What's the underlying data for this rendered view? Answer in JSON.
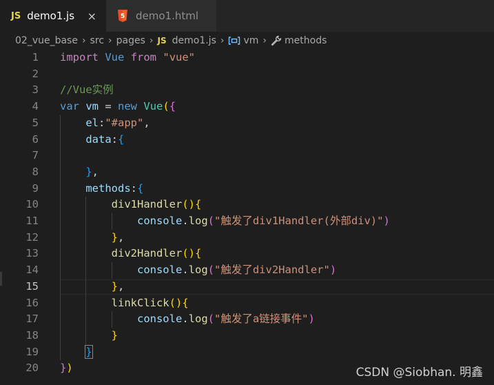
{
  "tabs": [
    {
      "badge": "JS",
      "label": "demo1.js",
      "close": "×",
      "active": true
    },
    {
      "badge": "5",
      "label": "demo1.html",
      "active": false
    }
  ],
  "breadcrumb": {
    "folder1": "02_vue_base",
    "folder2": "src",
    "folder3": "pages",
    "file_badge": "JS",
    "file": "demo1.js",
    "symbol1": "vm",
    "symbol2": "methods",
    "separator": "›"
  },
  "editor": {
    "current_line": 15,
    "line_numbers": [
      "1",
      "2",
      "3",
      "4",
      "5",
      "6",
      "7",
      "8",
      "9",
      "10",
      "11",
      "12",
      "13",
      "14",
      "15",
      "16",
      "17",
      "18",
      "19",
      "20"
    ],
    "lines": [
      [
        [
          "kw",
          "import"
        ],
        [
          "pl",
          " "
        ],
        [
          "vb",
          "Vue"
        ],
        [
          "pl",
          " "
        ],
        [
          "kw",
          "from"
        ],
        [
          "pl",
          " "
        ],
        [
          "st",
          "\"vue\""
        ]
      ],
      [],
      [
        [
          "cm",
          "//Vue实例"
        ]
      ],
      [
        [
          "vb",
          "var"
        ],
        [
          "pl",
          " "
        ],
        [
          "id",
          "vm"
        ],
        [
          "pl",
          " = "
        ],
        [
          "vb",
          "new"
        ],
        [
          "pl",
          " "
        ],
        [
          "tp",
          "Vue"
        ],
        [
          "b1",
          "("
        ],
        [
          "b2",
          "{"
        ]
      ],
      [
        [
          "pl",
          "    "
        ],
        [
          "id",
          "el"
        ],
        [
          "pl",
          ":"
        ],
        [
          "st",
          "\"#app\""
        ],
        [
          "pl",
          ","
        ]
      ],
      [
        [
          "pl",
          "    "
        ],
        [
          "id",
          "data"
        ],
        [
          "pl",
          ":"
        ],
        [
          "b3",
          "{"
        ]
      ],
      [],
      [
        [
          "pl",
          "    "
        ],
        [
          "b3",
          "}"
        ],
        [
          "pl",
          ","
        ]
      ],
      [
        [
          "pl",
          "    "
        ],
        [
          "id",
          "methods"
        ],
        [
          "pl",
          ":"
        ],
        [
          "b3",
          "{"
        ]
      ],
      [
        [
          "pl",
          "        "
        ],
        [
          "fn",
          "div1Handler"
        ],
        [
          "b1",
          "("
        ],
        [
          "b1",
          ")"
        ],
        [
          "b1",
          "{"
        ]
      ],
      [
        [
          "pl",
          "            "
        ],
        [
          "id",
          "console"
        ],
        [
          "pl",
          "."
        ],
        [
          "fn",
          "log"
        ],
        [
          "b2",
          "("
        ],
        [
          "st",
          "\"触发了div1Handler(外部div)\""
        ],
        [
          "b2",
          ")"
        ]
      ],
      [
        [
          "pl",
          "        "
        ],
        [
          "b1",
          "}"
        ],
        [
          "pl",
          ","
        ]
      ],
      [
        [
          "pl",
          "        "
        ],
        [
          "fn",
          "div2Handler"
        ],
        [
          "b1",
          "("
        ],
        [
          "b1",
          ")"
        ],
        [
          "b1",
          "{"
        ]
      ],
      [
        [
          "pl",
          "            "
        ],
        [
          "id",
          "console"
        ],
        [
          "pl",
          "."
        ],
        [
          "fn",
          "log"
        ],
        [
          "b2",
          "("
        ],
        [
          "st",
          "\"触发了div2Handler\""
        ],
        [
          "b2",
          ")"
        ]
      ],
      [
        [
          "pl",
          "        "
        ],
        [
          "b1",
          "}"
        ],
        [
          "pl",
          ","
        ]
      ],
      [
        [
          "pl",
          "        "
        ],
        [
          "fn",
          "linkClick"
        ],
        [
          "b1",
          "("
        ],
        [
          "b1",
          ")"
        ],
        [
          "b1",
          "{"
        ]
      ],
      [
        [
          "pl",
          "            "
        ],
        [
          "id",
          "console"
        ],
        [
          "pl",
          "."
        ],
        [
          "fn",
          "log"
        ],
        [
          "b2",
          "("
        ],
        [
          "st",
          "\"触发了a链接事件\""
        ],
        [
          "b2",
          ")"
        ]
      ],
      [
        [
          "pl",
          "        "
        ],
        [
          "b1",
          "}"
        ]
      ],
      [
        [
          "pl",
          "    "
        ],
        [
          "b3",
          "}"
        ]
      ],
      [
        [
          "b2",
          "}"
        ],
        [
          "b1",
          ")"
        ]
      ]
    ]
  },
  "watermark": "CSDN @Siobhan. 明鑫",
  "colors": {
    "background": "#1e1e1e",
    "keyword": "#c586c0",
    "string": "#ce9178",
    "comment": "#6a9955",
    "storage": "#569cd6",
    "type": "#4ec9b0",
    "variable": "#9cdcfe",
    "function": "#dcdcaa",
    "bracket_gold": "#ffd700",
    "bracket_orchid": "#da70d6",
    "bracket_blue": "#179fff"
  },
  "icons": {
    "tab1": "javascript-file-icon",
    "tab2": "html5-file-icon",
    "bc_file": "javascript-file-icon",
    "bc_symbol1": "variable-symbol-icon",
    "bc_symbol2": "wrench-property-icon"
  }
}
